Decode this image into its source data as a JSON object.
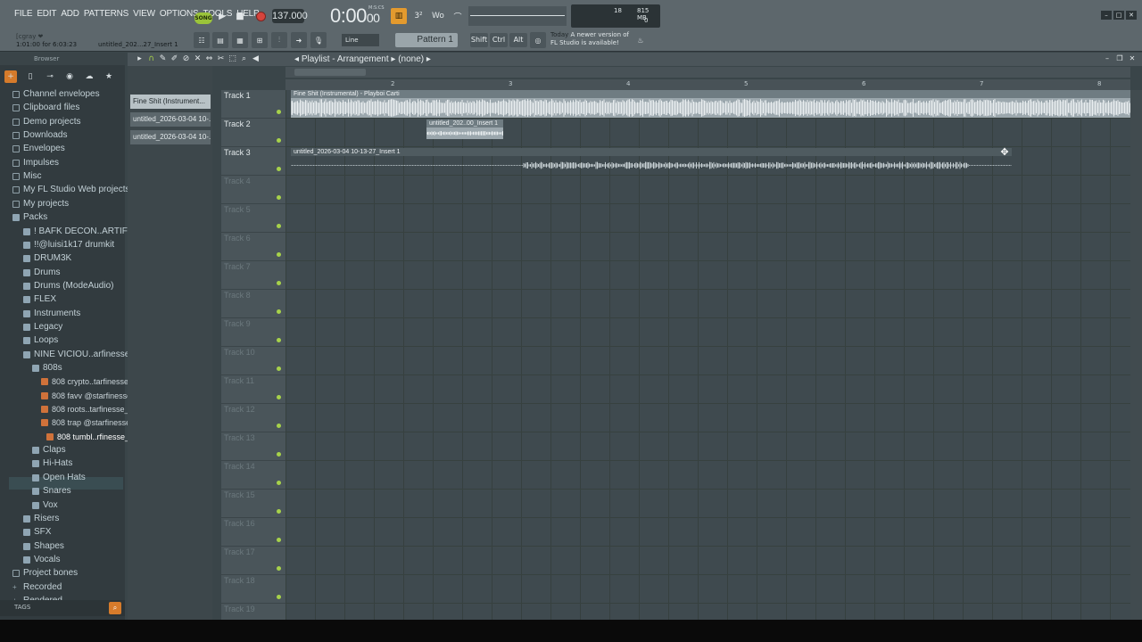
{
  "menu": [
    "FILE",
    "EDIT",
    "ADD",
    "PATTERNS",
    "VIEW",
    "OPTIONS",
    "TOOLS",
    "HELP"
  ],
  "transport": {
    "song_mode": "SONG",
    "tempo": "137.000",
    "time": "0:00",
    "time_fraction": "00",
    "time_unit": "M:S:CS",
    "pattern_label": "Pattern 1"
  },
  "monitor": {
    "cpu": "18",
    "memory": "815 MB",
    "polyphony": "0"
  },
  "hint_bar": {
    "user": "[cgray ❤",
    "position": "1:01:00 for 6:03:23",
    "project": "untitled_202...27_Insert 1"
  },
  "toolbar2": {
    "snap": "Line",
    "shift": "Shift",
    "ctrl": "Ctrl",
    "alt": "Alt"
  },
  "news": {
    "today": "Today",
    "line1": "A newer version of",
    "line2": "FL Studio is available!"
  },
  "browser": {
    "title": "Browser",
    "tags_label": "TAGS",
    "items": [
      {
        "label": "Channel envelopes",
        "type": "folder",
        "indent": 0
      },
      {
        "label": "Clipboard files",
        "type": "folder",
        "indent": 0
      },
      {
        "label": "Demo projects",
        "type": "folder",
        "indent": 0
      },
      {
        "label": "Downloads",
        "type": "folder",
        "indent": 0
      },
      {
        "label": "Envelopes",
        "type": "folder",
        "indent": 0
      },
      {
        "label": "Impulses",
        "type": "folder",
        "indent": 0
      },
      {
        "label": "Misc",
        "type": "folder",
        "indent": 0
      },
      {
        "label": "My FL Studio Web projects",
        "type": "folder",
        "indent": 0
      },
      {
        "label": "My projects",
        "type": "folder",
        "indent": 0
      },
      {
        "label": "Packs",
        "type": "pack",
        "indent": 0
      },
      {
        "label": "! BAFK DECON..ARTIFICIAL",
        "type": "pack",
        "indent": 1
      },
      {
        "label": "!!@luisi1k17 drumkit",
        "type": "pack",
        "indent": 1
      },
      {
        "label": "DRUM3K",
        "type": "pack",
        "indent": 1
      },
      {
        "label": "Drums",
        "type": "pack",
        "indent": 1
      },
      {
        "label": "Drums (ModeAudio)",
        "type": "pack",
        "indent": 1
      },
      {
        "label": "FLEX",
        "type": "pack",
        "indent": 1
      },
      {
        "label": "Instruments",
        "type": "pack",
        "indent": 1
      },
      {
        "label": "Legacy",
        "type": "pack",
        "indent": 1
      },
      {
        "label": "Loops",
        "type": "pack",
        "indent": 1
      },
      {
        "label": "NINE VICIOU..arfinesse_",
        "type": "pack",
        "indent": 1
      },
      {
        "label": "808s",
        "type": "pack",
        "indent": 2
      },
      {
        "label": "808 crypto..tarfinesse_",
        "type": "file",
        "indent": 3
      },
      {
        "label": "808 favv @starfinesse_",
        "type": "file",
        "indent": 3
      },
      {
        "label": "808 roots..tarfinesse_",
        "type": "file",
        "indent": 3
      },
      {
        "label": "808 trap @starfinesse_",
        "type": "file",
        "indent": 3
      },
      {
        "label": "808 tumbl..rfinesse_",
        "type": "file",
        "indent": 4,
        "selected": true
      },
      {
        "label": "Claps",
        "type": "pack",
        "indent": 2
      },
      {
        "label": "Hi-Hats",
        "type": "pack",
        "indent": 2
      },
      {
        "label": "Open Hats",
        "type": "pack",
        "indent": 2
      },
      {
        "label": "Snares",
        "type": "pack",
        "indent": 2
      },
      {
        "label": "Vox",
        "type": "pack",
        "indent": 2
      },
      {
        "label": "Risers",
        "type": "pack",
        "indent": 1
      },
      {
        "label": "SFX",
        "type": "pack",
        "indent": 1
      },
      {
        "label": "Shapes",
        "type": "pack",
        "indent": 1
      },
      {
        "label": "Vocals",
        "type": "pack",
        "indent": 1
      },
      {
        "label": "Project bones",
        "type": "folder",
        "indent": 0
      },
      {
        "label": "Recorded",
        "type": "plus",
        "indent": 0
      },
      {
        "label": "Rendered",
        "type": "plus",
        "indent": 0
      }
    ]
  },
  "picker": {
    "items": [
      "Fine Shit (Instrument...",
      "untitled_2026-03-04 10-...",
      "untitled_2026-03-04 10-..."
    ]
  },
  "playlist": {
    "title": "Playlist - Arrangement",
    "arrangement": "(none)",
    "bars": [
      "2",
      "3",
      "4",
      "5",
      "6",
      "7",
      "8"
    ],
    "tracks": [
      "Track 1",
      "Track 2",
      "Track 3",
      "Track 4",
      "Track 5",
      "Track 6",
      "Track 7",
      "Track 8",
      "Track 9",
      "Track 10",
      "Track 11",
      "Track 12",
      "Track 13",
      "Track 14",
      "Track 15",
      "Track 16",
      "Track 17",
      "Track 18",
      "Track 19"
    ],
    "clips": [
      {
        "name": "Fine Shit (Instrumental) - Playboi Carti",
        "track": 1
      },
      {
        "name": "untitled_202..00_Insert 1",
        "track": 2
      },
      {
        "name": "untitled_2026-03-04 10-13-27_Insert 1",
        "track": 3
      }
    ]
  },
  "colors": {
    "accent": "#d67b2b",
    "mute_led": "#a7d24a",
    "record": "#d5443c"
  }
}
